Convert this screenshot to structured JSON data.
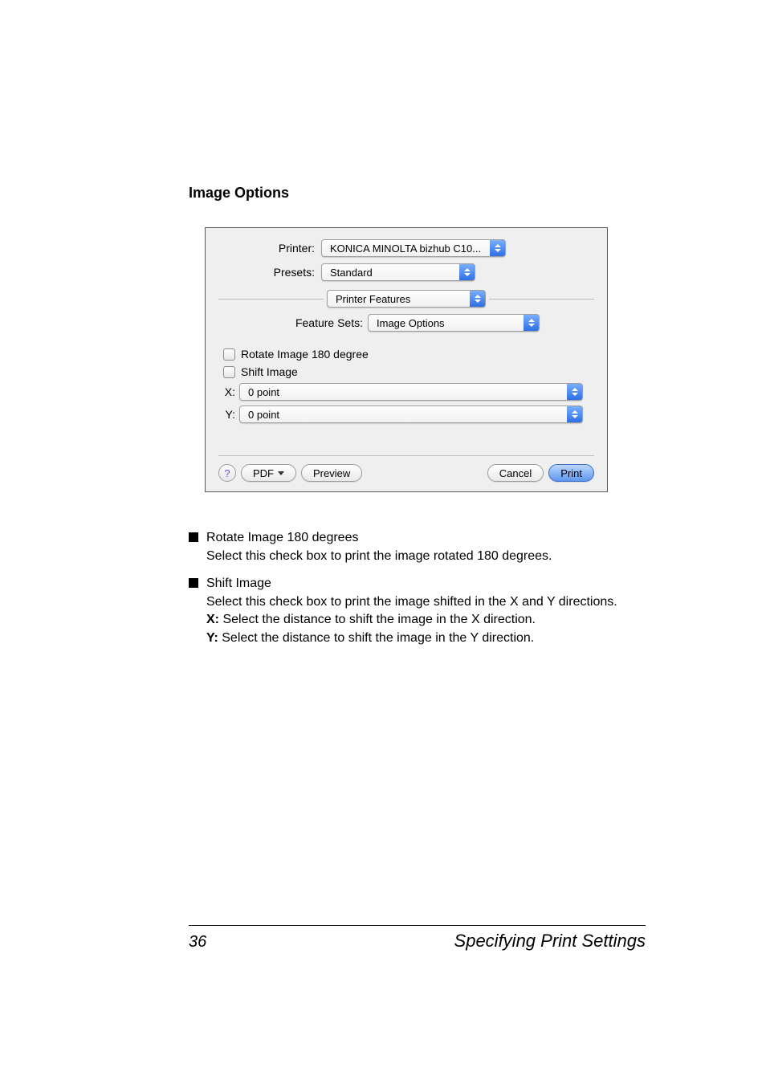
{
  "heading": "Image Options",
  "dialog": {
    "printer_label": "Printer:",
    "printer_value": "KONICA MINOLTA bizhub C10...",
    "presets_label": "Presets:",
    "presets_value": "Standard",
    "section_value": "Printer Features",
    "feature_sets_label": "Feature Sets:",
    "feature_sets_value": "Image Options",
    "rotate_label": "Rotate Image 180 degree",
    "shift_label": "Shift Image",
    "x_label": "X:",
    "x_value": "0 point",
    "y_label": "Y:",
    "y_value": "0 point",
    "help": "?",
    "pdf_btn": "PDF",
    "preview_btn": "Preview",
    "cancel_btn": "Cancel",
    "print_btn": "Print"
  },
  "body": {
    "b1_title": "Rotate Image 180 degrees",
    "b1_desc": "Select this check box to print the image rotated 180 degrees.",
    "b2_title": "Shift Image",
    "b2_desc": "Select this check box to print the image shifted in the X and Y directions.",
    "b2_x_label": "X:",
    "b2_x_text": " Select the distance to shift the image in the X direction.",
    "b2_y_label": "Y:",
    "b2_y_text": " Select the distance to shift the image in the Y direction."
  },
  "footer": {
    "page": "36",
    "title": "Specifying Print Settings"
  }
}
